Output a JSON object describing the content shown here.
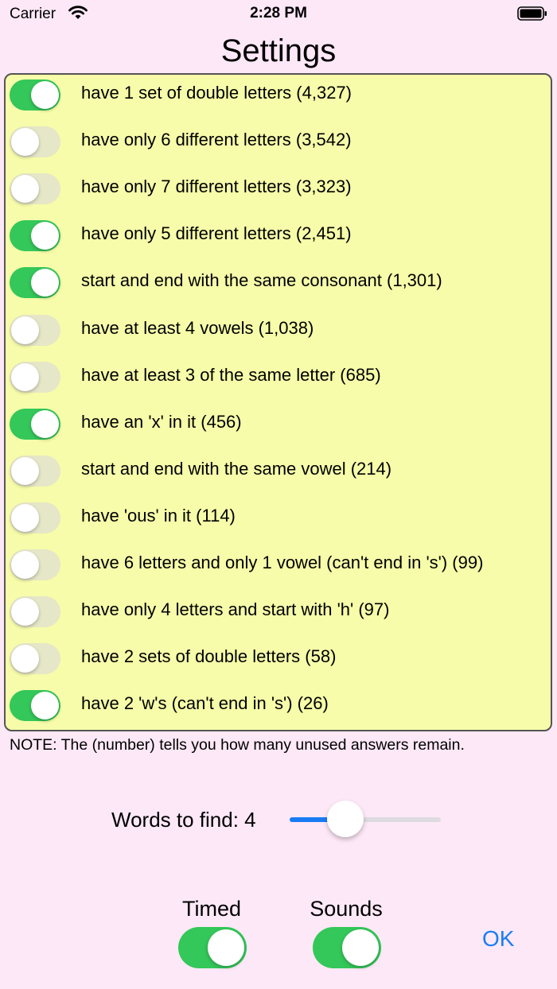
{
  "status_bar": {
    "carrier": "Carrier",
    "time": "2:28 PM",
    "icons": [
      "wifi-icon",
      "battery-icon"
    ]
  },
  "title": "Settings",
  "options": [
    {
      "label": "have 1 set of double letters (4,327)",
      "on": true
    },
    {
      "label": "have only 6 different letters (3,542)",
      "on": false
    },
    {
      "label": "have only 7 different letters (3,323)",
      "on": false
    },
    {
      "label": "have only 5 different letters (2,451)",
      "on": true
    },
    {
      "label": "start and end with the same consonant (1,301)",
      "on": true
    },
    {
      "label": "have at least 4 vowels (1,038)",
      "on": false
    },
    {
      "label": "have at least 3 of the same letter (685)",
      "on": false
    },
    {
      "label": "have an 'x' in it (456)",
      "on": true
    },
    {
      "label": "start and end with the same vowel (214)",
      "on": false
    },
    {
      "label": "have 'ous' in it (114)",
      "on": false
    },
    {
      "label": "have 6 letters and only 1 vowel (can't end in 's') (99)",
      "on": false
    },
    {
      "label": "have only 4 letters and start with 'h' (97)",
      "on": false
    },
    {
      "label": "have 2 sets of double letters (58)",
      "on": false
    },
    {
      "label": "have 2 'w's (can't end in 's') (26)",
      "on": true
    }
  ],
  "note": "NOTE: The (number) tells you how many unused answers remain.",
  "words_to_find": {
    "label": "Words to find: 4",
    "slider_fraction": 0.37
  },
  "timed": {
    "label": "Timed",
    "on": true
  },
  "sounds": {
    "label": "Sounds",
    "on": true
  },
  "ok_label": "OK",
  "colors": {
    "background": "#fde8f7",
    "panel": "#f6fca9",
    "toggle_on": "#34c759",
    "toggle_off": "#e6e6c8",
    "accent": "#1a7cf5"
  }
}
